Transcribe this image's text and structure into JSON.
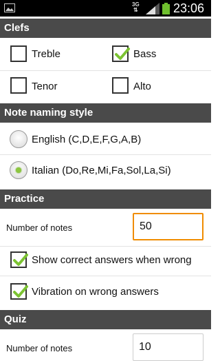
{
  "status_bar": {
    "network": "3G",
    "time": "23:06",
    "icons": [
      "image-icon",
      "signal-icon",
      "battery-icon"
    ]
  },
  "sections": {
    "clefs": "Clefs",
    "note_naming": "Note naming style",
    "practice": "Practice",
    "quiz": "Quiz"
  },
  "clefs": [
    {
      "label": "Treble",
      "checked": false
    },
    {
      "label": "Bass",
      "checked": true
    },
    {
      "label": "Tenor",
      "checked": false
    },
    {
      "label": "Alto",
      "checked": false
    }
  ],
  "note_naming": [
    {
      "label": "English (C,D,E,F,G,A,B)",
      "selected": false
    },
    {
      "label": "Italian (Do,Re,Mi,Fa,Sol,La,Si)",
      "selected": true
    }
  ],
  "practice": {
    "number_label": "Number of notes",
    "number_value": "50",
    "options": [
      {
        "label": "Show correct answers when wrong",
        "checked": true
      },
      {
        "label": "Vibration on wrong answers",
        "checked": true
      }
    ]
  },
  "quiz": {
    "number_label": "Number of notes",
    "number_value": "10"
  },
  "colors": {
    "section_bg": "#4a4a4a",
    "check_green": "#7cc332",
    "focus_orange": "#f08c00"
  }
}
